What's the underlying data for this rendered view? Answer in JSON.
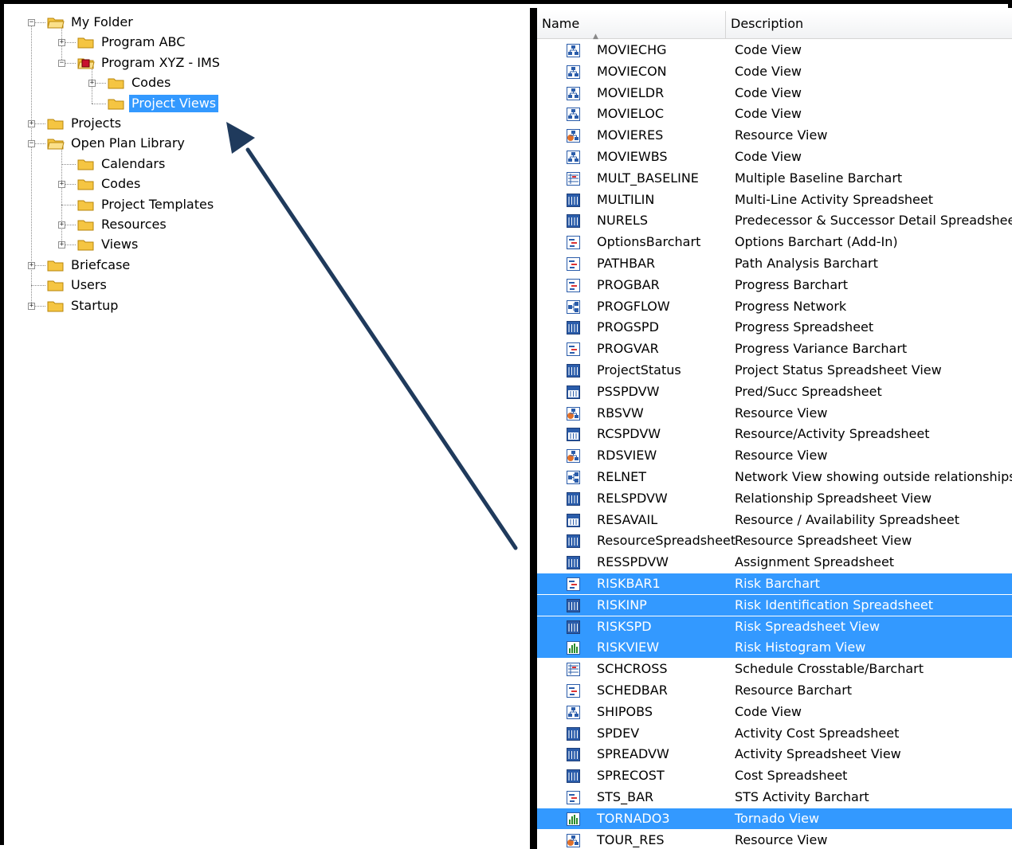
{
  "tree": {
    "nodes": [
      {
        "id": "my-folder",
        "label": "My Folder",
        "expander": "−"
      },
      {
        "id": "program-abc",
        "label": "Program ABC",
        "expander": "+"
      },
      {
        "id": "program-xyz",
        "label": "Program XYZ - IMS",
        "expander": "−"
      },
      {
        "id": "codes-1",
        "label": "Codes",
        "expander": "+"
      },
      {
        "id": "project-views",
        "label": "Project Views",
        "expander": "",
        "selected": true
      },
      {
        "id": "projects",
        "label": "Projects",
        "expander": "+"
      },
      {
        "id": "open-plan-library",
        "label": "Open Plan Library",
        "expander": "−"
      },
      {
        "id": "calendars",
        "label": "Calendars",
        "expander": ""
      },
      {
        "id": "codes-2",
        "label": "Codes",
        "expander": "+"
      },
      {
        "id": "project-templates",
        "label": "Project Templates",
        "expander": ""
      },
      {
        "id": "resources",
        "label": "Resources",
        "expander": "+"
      },
      {
        "id": "views",
        "label": "Views",
        "expander": "+"
      },
      {
        "id": "briefcase",
        "label": "Briefcase",
        "expander": "+"
      },
      {
        "id": "users",
        "label": "Users",
        "expander": ""
      },
      {
        "id": "startup",
        "label": "Startup",
        "expander": "+"
      }
    ]
  },
  "list": {
    "columns": {
      "name": "Name",
      "description": "Description",
      "sort_indicator": "▲"
    },
    "rows": [
      {
        "name": "MOVIECHG",
        "description": "Code View",
        "icon": "code-view-icon",
        "selected": false
      },
      {
        "name": "MOVIECON",
        "description": "Code View",
        "icon": "code-view-icon",
        "selected": false
      },
      {
        "name": "MOVIELDR",
        "description": "Code View",
        "icon": "code-view-icon",
        "selected": false
      },
      {
        "name": "MOVIELOC",
        "description": "Code View",
        "icon": "code-view-icon",
        "selected": false
      },
      {
        "name": "MOVIERES",
        "description": "Resource View",
        "icon": "resource-view-icon",
        "selected": false
      },
      {
        "name": "MOVIEWBS",
        "description": "Code View",
        "icon": "code-view-icon",
        "selected": false
      },
      {
        "name": "MULT_BASELINE",
        "description": "Multiple Baseline Barchart",
        "icon": "crosstab-icon",
        "selected": false
      },
      {
        "name": "MULTILIN",
        "description": "Multi-Line Activity Spreadsheet",
        "icon": "spreadsheet-icon",
        "selected": false
      },
      {
        "name": "NURELS",
        "description": "Predecessor & Successor Detail Spreadsheet",
        "icon": "spreadsheet-icon",
        "selected": false
      },
      {
        "name": "OptionsBarchart",
        "description": "Options Barchart (Add-In)",
        "icon": "barchart-icon",
        "selected": false
      },
      {
        "name": "PATHBAR",
        "description": "Path Analysis Barchart",
        "icon": "barchart-icon",
        "selected": false
      },
      {
        "name": "PROGBAR",
        "description": "Progress Barchart",
        "icon": "barchart-icon",
        "selected": false
      },
      {
        "name": "PROGFLOW",
        "description": "Progress Network",
        "icon": "network-icon",
        "selected": false
      },
      {
        "name": "PROGSPD",
        "description": "Progress Spreadsheet",
        "icon": "spreadsheet-icon",
        "selected": false
      },
      {
        "name": "PROGVAR",
        "description": "Progress Variance Barchart",
        "icon": "barchart-icon",
        "selected": false
      },
      {
        "name": "ProjectStatus",
        "description": "Project Status Spreadsheet View",
        "icon": "spreadsheet-icon",
        "selected": false
      },
      {
        "name": "PSSPDVW",
        "description": "Pred/Succ Spreadsheet",
        "icon": "split-spreadsheet-icon",
        "selected": false
      },
      {
        "name": "RBSVW",
        "description": "Resource View",
        "icon": "resource-view-icon",
        "selected": false
      },
      {
        "name": "RCSPDVW",
        "description": "Resource/Activity Spreadsheet",
        "icon": "split-spreadsheet-icon",
        "selected": false
      },
      {
        "name": "RDSVIEW",
        "description": "Resource View",
        "icon": "resource-view-icon",
        "selected": false
      },
      {
        "name": "RELNET",
        "description": "Network View showing outside relationships",
        "icon": "network-icon",
        "selected": false
      },
      {
        "name": "RELSPDVW",
        "description": "Relationship Spreadsheet View",
        "icon": "spreadsheet-icon",
        "selected": false
      },
      {
        "name": "RESAVAIL",
        "description": "Resource / Availability Spreadsheet",
        "icon": "split-spreadsheet-icon",
        "selected": false
      },
      {
        "name": "ResourceSpreadsheet",
        "description": "Resource Spreadsheet View",
        "icon": "spreadsheet-icon",
        "selected": false
      },
      {
        "name": "RESSPDVW",
        "description": "Assignment Spreadsheet",
        "icon": "spreadsheet-icon",
        "selected": false
      },
      {
        "name": "RISKBAR1",
        "description": "Risk Barchart",
        "icon": "barchart-icon",
        "selected": true
      },
      {
        "name": "RISKINP",
        "description": "Risk Identification Spreadsheet",
        "icon": "spreadsheet-icon",
        "selected": true
      },
      {
        "name": "RISKSPD",
        "description": "Risk Spreadsheet View",
        "icon": "spreadsheet-icon",
        "selected": true
      },
      {
        "name": "RISKVIEW",
        "description": "Risk Histogram View",
        "icon": "histogram-icon",
        "selected": true
      },
      {
        "name": "SCHCROSS",
        "description": "Schedule Crosstable/Barchart",
        "icon": "crosstab-icon",
        "selected": false
      },
      {
        "name": "SCHEDBAR",
        "description": "Resource Barchart",
        "icon": "barchart-icon",
        "selected": false
      },
      {
        "name": "SHIPOBS",
        "description": "Code View",
        "icon": "code-view-icon",
        "selected": false
      },
      {
        "name": "SPDEV",
        "description": "Activity Cost Spreadsheet",
        "icon": "spreadsheet-icon",
        "selected": false
      },
      {
        "name": "SPREADVW",
        "description": "Activity Spreadsheet View",
        "icon": "spreadsheet-icon",
        "selected": false
      },
      {
        "name": "SPRECOST",
        "description": "Cost Spreadsheet",
        "icon": "spreadsheet-icon",
        "selected": false
      },
      {
        "name": "STS_BAR",
        "description": "STS Activity Barchart",
        "icon": "barchart-icon",
        "selected": false
      },
      {
        "name": "TORNADO3",
        "description": "Tornado View",
        "icon": "histogram-icon",
        "selected": true
      },
      {
        "name": "TOUR_RES",
        "description": "Resource View",
        "icon": "resource-view-icon",
        "selected": false
      }
    ]
  },
  "colors": {
    "selection": "#3399ff",
    "arrow": "#1f3a5c",
    "folder": "#f5c542"
  }
}
